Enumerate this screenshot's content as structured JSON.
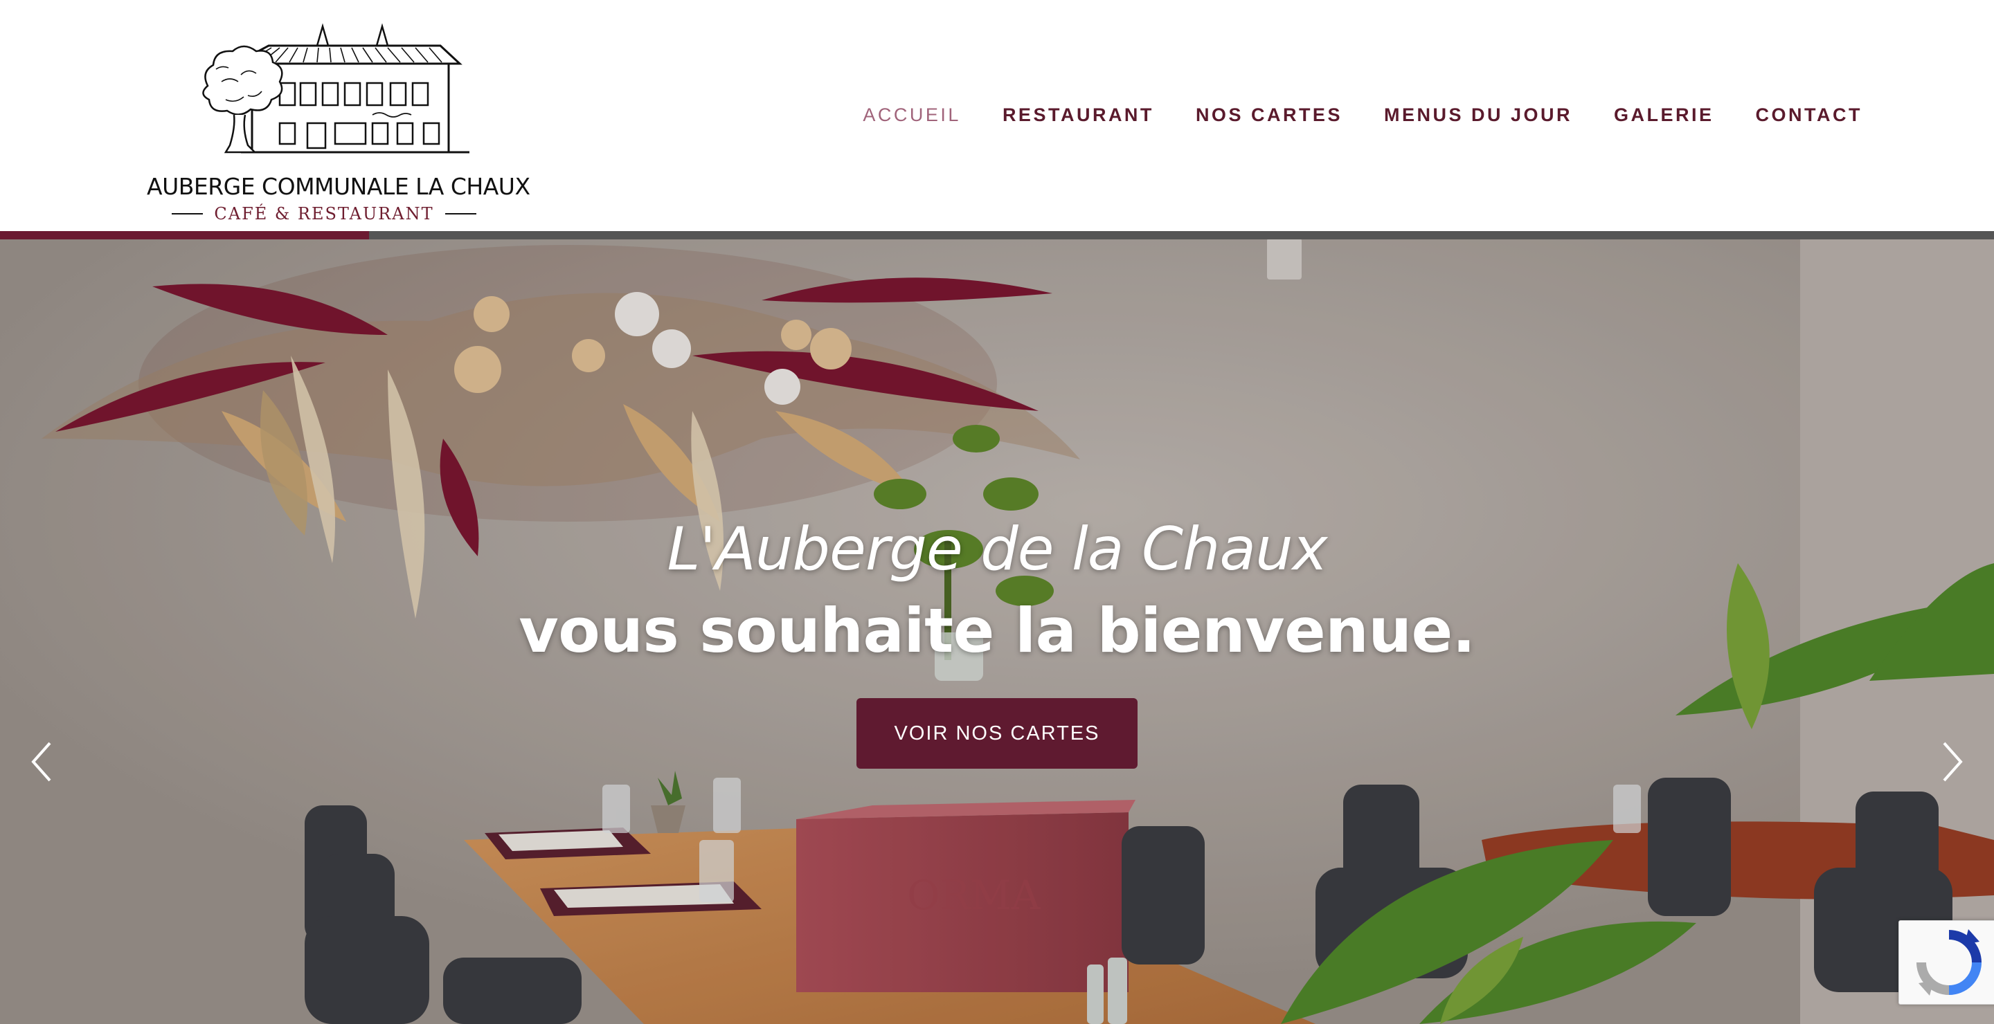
{
  "site": {
    "logo": {
      "title": "AUBERGE COMMUNALE LA CHAUX",
      "subtitle": "CAFÉ & RESTAURANT",
      "icon": "auberge-building-logo"
    },
    "nav": {
      "items": [
        {
          "label": "ACCUEIL",
          "active": true
        },
        {
          "label": "RESTAURANT",
          "active": false
        },
        {
          "label": "NOS CARTES",
          "active": false
        },
        {
          "label": "MENUS DU JOUR",
          "active": false
        },
        {
          "label": "GALERIE",
          "active": false
        },
        {
          "label": "CONTACT",
          "active": false
        }
      ]
    }
  },
  "hero": {
    "line1": "L'Auberge de la Chaux",
    "line2": "vous souhaite la bienvenue.",
    "cta_label": "VOIR NOS CARTES",
    "slider_progress": 0.185,
    "prev_icon": "chevron-left-icon",
    "next_icon": "chevron-right-icon"
  },
  "widgets": {
    "recaptcha_icon": "recaptcha-icon"
  },
  "colors": {
    "brand": "#5f1a30",
    "nav_text": "#5a1a2c",
    "nav_active": "#a0637a",
    "progress_track": "#555555"
  }
}
